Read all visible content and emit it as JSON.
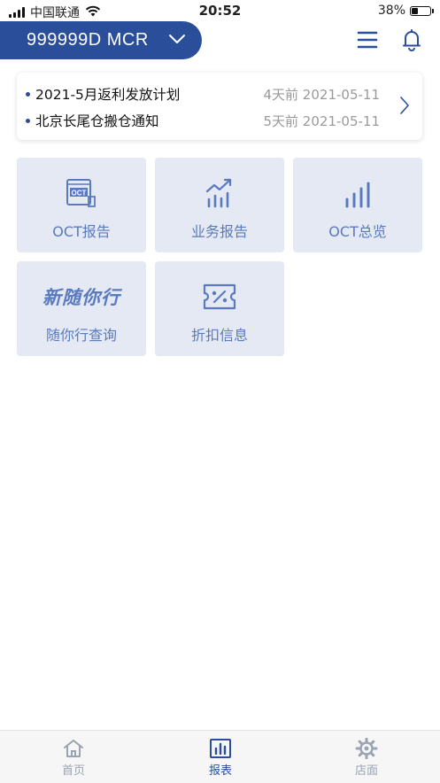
{
  "status_bar": {
    "carrier": "中国联通",
    "time": "20:52",
    "battery": "38%",
    "battery_level": 0.38
  },
  "header": {
    "account": "999999D MCR",
    "icons": [
      "chevron-down-icon",
      "menu-icon",
      "bell-icon"
    ]
  },
  "notices": [
    {
      "title": "2021-5月返利发放计划",
      "date": "4天前 2021-05-11"
    },
    {
      "title": "北京长尾仓搬仓通知",
      "date": "5天前 2021-05-11"
    }
  ],
  "tiles": [
    {
      "label": "OCT报告",
      "icon": "oct-report-icon",
      "icon_text": "OCT"
    },
    {
      "label": "业务报告",
      "icon": "trend-chart-icon"
    },
    {
      "label": "OCT总览",
      "icon": "bar-chart-icon"
    },
    {
      "label": "随你行查询",
      "icon": "brand-logo",
      "icon_text": "新随你行"
    },
    {
      "label": "折扣信息",
      "icon": "discount-ticket-icon"
    }
  ],
  "tab_bar": {
    "tabs": [
      {
        "label": "首页",
        "icon": "home-icon",
        "active": false
      },
      {
        "label": "报表",
        "icon": "report-icon",
        "active": true
      },
      {
        "label": "店面",
        "icon": "gear-icon",
        "active": false
      }
    ],
    "active_color": "#2b4e9a",
    "inactive_color": "#9aa3b2"
  },
  "colors": {
    "brand": "#2b4e9a",
    "tile_bg": "#e5e9f3",
    "tile_text": "#5a7abf"
  }
}
